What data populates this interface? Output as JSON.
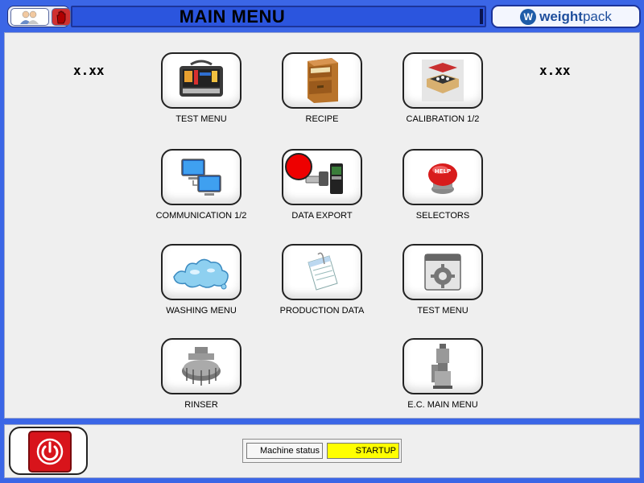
{
  "header": {
    "title": "MAIN MENU",
    "logo_text_bold": "weight",
    "logo_text_light": "pack"
  },
  "versions": {
    "left": "x.xx",
    "right": "x.xx"
  },
  "menu": [
    {
      "label": "TEST MENU",
      "icon": "toolbox-icon"
    },
    {
      "label": "RECIPE",
      "icon": "file-cabinet-icon"
    },
    {
      "label": "CALIBRATION 1/2",
      "icon": "calibration-case-icon"
    },
    {
      "label": "COMMUNICATION 1/2",
      "icon": "network-computers-icon"
    },
    {
      "label": "DATA EXPORT",
      "icon": "usb-drive-icon"
    },
    {
      "label": "SELECTORS",
      "icon": "help-button-icon"
    },
    {
      "label": "WASHING MENU",
      "icon": "water-splash-icon"
    },
    {
      "label": "PRODUCTION DATA",
      "icon": "document-icon"
    },
    {
      "label": "TEST MENU",
      "icon": "gear-icon"
    },
    {
      "label": "RINSER",
      "icon": "rinser-machine-icon"
    },
    {
      "label": "E.C. MAIN MENU",
      "icon": "filler-machine-icon"
    }
  ],
  "footer": {
    "status_label": "Machine status",
    "status_value": "STARTUP"
  },
  "colors": {
    "background": "#3b66e6",
    "title_bar": "#2b55de",
    "status_value": "#ffff00",
    "power_button": "#d8141b",
    "alert_dot": "#e00000"
  }
}
